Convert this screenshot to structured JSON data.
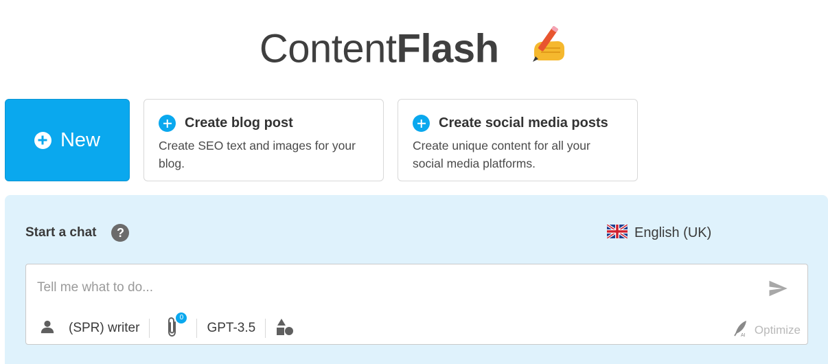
{
  "logo": {
    "light_text": "Content",
    "bold_text": "Flash",
    "emoji_icon": "writing-hand-icon"
  },
  "new_button": {
    "label": "New",
    "icon": "plus-circle-icon",
    "color": "#0aa8ee"
  },
  "cards": [
    {
      "title": "Create blog post",
      "description": "Create SEO text and images for your blog.",
      "icon": "plus-circle-icon"
    },
    {
      "title": "Create social media posts",
      "description": "Create unique content for all your social media platforms.",
      "icon": "plus-circle-icon"
    }
  ],
  "chat": {
    "heading": "Start a chat",
    "help_icon": "question-circle-icon",
    "help_glyph": "?",
    "language": {
      "label": "English (UK)",
      "flag_icon": "uk-flag-icon"
    },
    "input": {
      "placeholder": "Tell me what to do...",
      "value": ""
    },
    "send_icon": "send-icon",
    "toolbar": {
      "persona_label": "(SPR) writer",
      "persona_icon": "person-icon",
      "attachment_icon": "paperclip-icon",
      "attachment_count": "0",
      "model_label": "GPT-3.5",
      "shapes_icon": "shapes-icon"
    },
    "optimize": {
      "label": "Optimize",
      "icon": "feather-ai-icon"
    },
    "panel_color": "#dff2fc"
  }
}
